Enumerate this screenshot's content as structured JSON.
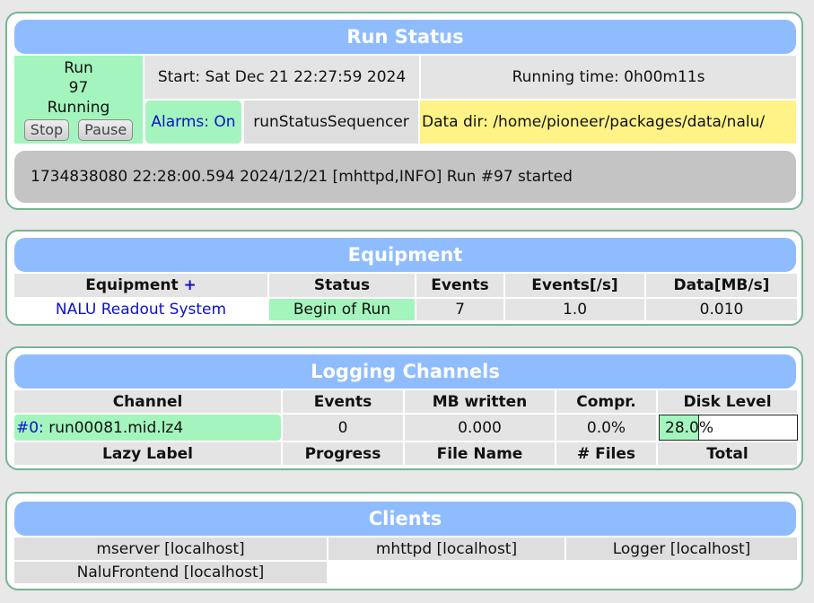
{
  "run_status": {
    "title": "Run Status",
    "state_label": "Run",
    "run_number": "97",
    "state": "Running",
    "buttons": {
      "stop": "Stop",
      "pause": "Pause"
    },
    "start": "Start: Sat Dec 21 22:27:59 2024",
    "running_time": "Running time: 0h00m11s",
    "alarms": "Alarms: On",
    "sequencer": "runStatusSequencer",
    "data_dir": "Data dir: /home/pioneer/packages/data/nalu/",
    "message": "1734838080 22:28:00.594 2024/12/21 [mhttpd,INFO] Run #97 started"
  },
  "equipment": {
    "title": "Equipment",
    "columns": {
      "equipment": "Equipment",
      "add": "+",
      "status": "Status",
      "events": "Events",
      "rate": "Events[/s]",
      "data": "Data[MB/s]"
    },
    "rows": [
      {
        "name": "NALU Readout System",
        "status": "Begin of Run",
        "events": "7",
        "rate": "1.0",
        "data": "0.010"
      }
    ]
  },
  "logging": {
    "title": "Logging Channels",
    "columns": [
      "Channel",
      "Events",
      "MB written",
      "Compr.",
      "Disk Level"
    ],
    "row": {
      "channel_id": "#0:",
      "file": "run00081.mid.lz4",
      "events": "0",
      "mb_written": "0.000",
      "compr": "0.0%",
      "disk_level": "28.0%",
      "disk_level_fraction": 0.28
    },
    "lazy_columns": [
      "Lazy Label",
      "Progress",
      "File Name",
      "# Files",
      "Total"
    ]
  },
  "clients": {
    "title": "Clients",
    "items": [
      "mserver [localhost]",
      "mhttpd [localhost]",
      "Logger [localhost]",
      "NaluFrontend [localhost]"
    ]
  },
  "colors": {
    "header": "#8fbcff",
    "ok_green": "#a3f5bd",
    "warn_yellow": "#fff388",
    "border": "#75b594",
    "link": "#0d12c9"
  }
}
